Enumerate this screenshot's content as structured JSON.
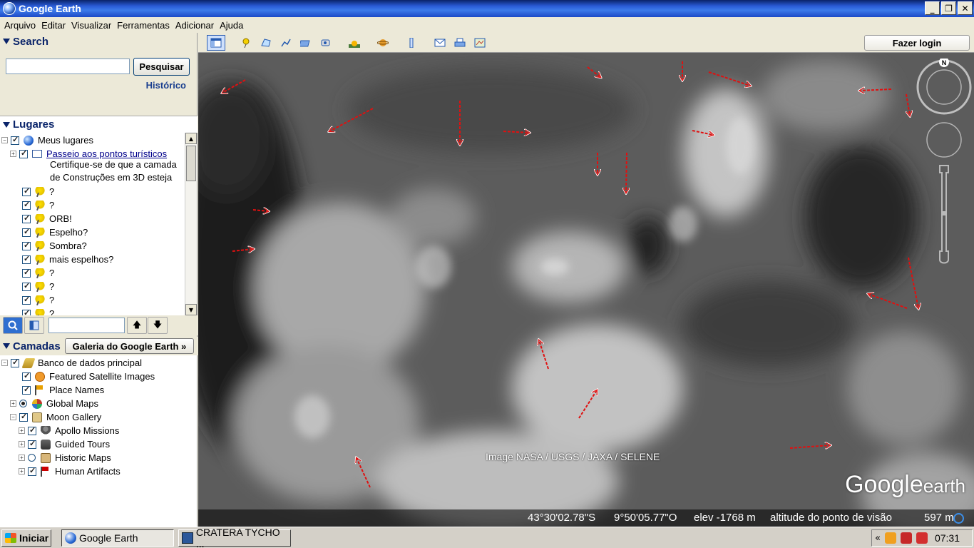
{
  "window": {
    "title": "Google Earth",
    "buttons": [
      "_",
      "❐",
      "✕"
    ]
  },
  "menu": [
    "Arquivo",
    "Editar",
    "Visualizar",
    "Ferramentas",
    "Adicionar",
    "Ajuda"
  ],
  "search": {
    "header": "Search",
    "input_value": "",
    "button_label": "Pesquisar",
    "history_label": "Histórico"
  },
  "places": {
    "header": "Lugares",
    "root": "Meus lugares",
    "tour_link": "Passeio aos pontos turísticos",
    "tour_note_1": "Certifique-se de que a camada",
    "tour_note_2": "de Construções em 3D esteja",
    "items": [
      "?",
      "?",
      "ORB!",
      "Espelho?",
      "Sombra?",
      "mais espelhos?",
      "?",
      "?",
      "?",
      "?"
    ]
  },
  "layers": {
    "header": "Camadas",
    "gallery_button": "Galeria do Google Earth",
    "gallery_arrow": "»",
    "items": [
      {
        "label": "Banco de dados principal",
        "icon": "layers-icon"
      },
      {
        "label": "Featured Satellite Images",
        "icon": "satellite-icon"
      },
      {
        "label": "Place Names",
        "icon": "flag-icon"
      },
      {
        "label": "Global Maps",
        "icon": "global-maps-icon"
      },
      {
        "label": "Moon Gallery",
        "icon": "moon-gallery-icon"
      },
      {
        "label": "Apollo Missions",
        "icon": "apollo-icon"
      },
      {
        "label": "Guided Tours",
        "icon": "tour-icon"
      },
      {
        "label": "Historic Maps",
        "icon": "scroll-icon"
      },
      {
        "label": "Human Artifacts",
        "icon": "red-flag-icon"
      }
    ]
  },
  "toolbar": {
    "login_label": "Fazer login"
  },
  "map": {
    "attribution": "Image NASA / USGS / JAXA / SELENE",
    "logo_word_1": "Google",
    "logo_word_2": "earth",
    "compass_north": "N",
    "lat": "43°30'02.78\"S",
    "lon": "9°50'05.77\"O",
    "elev": "elev -1768 m",
    "eye_label": "altitude do ponto de visão",
    "eye_value": "597 m"
  },
  "taskbar": {
    "start_label": "Iniciar",
    "tasks": [
      "Google Earth",
      "CRATERA TYCHO ..."
    ],
    "tray_chevron": "«",
    "clock": "07:31"
  },
  "colors": {
    "titlebar": "#2a5bd6",
    "panel_header": "#0a246a",
    "arrow_red": "#e01010"
  }
}
